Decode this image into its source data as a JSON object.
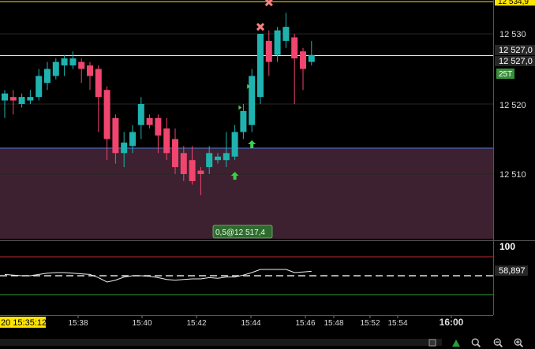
{
  "chart_data": {
    "type": "candlestick",
    "instrument_timeframe": "25T",
    "price_labels": [
      "12 534,9",
      "12 530",
      "12 527,0",
      "12 527,0",
      "12 520",
      "12 510"
    ],
    "cursor_time_label": "20 15:35:12",
    "time_labels": [
      "15:38",
      "15:40",
      "15:42",
      "15:44",
      "15:46",
      "15:48",
      "15:52",
      "15:54",
      "16:00"
    ],
    "order_label": "0,5@12 517,4",
    "candles": [
      {
        "o": 12520.5,
        "h": 12522,
        "l": 12518,
        "c": 12521.5
      },
      {
        "o": 12521,
        "h": 12522,
        "l": 12518.5,
        "c": 12520.5
      },
      {
        "o": 12520,
        "h": 12521.5,
        "l": 12519.5,
        "c": 12521
      },
      {
        "o": 12520.5,
        "h": 12522,
        "l": 12520,
        "c": 12521
      },
      {
        "o": 12521,
        "h": 12525,
        "l": 12520.5,
        "c": 12524
      },
      {
        "o": 12523,
        "h": 12526,
        "l": 12522,
        "c": 12525
      },
      {
        "o": 12524,
        "h": 12526.5,
        "l": 12523.5,
        "c": 12526
      },
      {
        "o": 12525.5,
        "h": 12527,
        "l": 12524,
        "c": 12526.5
      },
      {
        "o": 12525.5,
        "h": 12527.5,
        "l": 12525,
        "c": 12526.5
      },
      {
        "o": 12526,
        "h": 12526.5,
        "l": 12523,
        "c": 12525
      },
      {
        "o": 12525.5,
        "h": 12526,
        "l": 12522,
        "c": 12524
      },
      {
        "o": 12525,
        "h": 12525.5,
        "l": 12516,
        "c": 12521
      },
      {
        "o": 12522,
        "h": 12522.5,
        "l": 12512,
        "c": 12515
      },
      {
        "o": 12518,
        "h": 12518.5,
        "l": 12511.5,
        "c": 12513
      },
      {
        "o": 12513,
        "h": 12516,
        "l": 12511,
        "c": 12514.5
      },
      {
        "o": 12514,
        "h": 12517,
        "l": 12513,
        "c": 12516
      },
      {
        "o": 12517,
        "h": 12521,
        "l": 12515,
        "c": 12520
      },
      {
        "o": 12518,
        "h": 12518.5,
        "l": 12516.5,
        "c": 12517
      },
      {
        "o": 12518,
        "h": 12518.5,
        "l": 12513,
        "c": 12515.5
      },
      {
        "o": 12516.5,
        "h": 12518,
        "l": 12512,
        "c": 12513
      },
      {
        "o": 12515,
        "h": 12516.5,
        "l": 12510,
        "c": 12511
      },
      {
        "o": 12513,
        "h": 12514,
        "l": 12509,
        "c": 12510
      },
      {
        "o": 12512,
        "h": 12514,
        "l": 12508.5,
        "c": 12509
      },
      {
        "o": 12510.5,
        "h": 12511,
        "l": 12507,
        "c": 12510
      },
      {
        "o": 12511,
        "h": 12514,
        "l": 12510,
        "c": 12513
      },
      {
        "o": 12512,
        "h": 12513,
        "l": 12511.5,
        "c": 12512.5
      },
      {
        "o": 12512,
        "h": 12516,
        "l": 12511,
        "c": 12513
      },
      {
        "o": 12512.5,
        "h": 12517,
        "l": 12512,
        "c": 12516
      },
      {
        "o": 12516,
        "h": 12520,
        "l": 12515,
        "c": 12519
      },
      {
        "o": 12517,
        "h": 12525,
        "l": 12516,
        "c": 12524
      },
      {
        "o": 12521,
        "h": 12530,
        "l": 12520,
        "c": 12530
      },
      {
        "o": 12529,
        "h": 12530.5,
        "l": 12524,
        "c": 12526
      },
      {
        "o": 12527,
        "h": 12531,
        "l": 12526,
        "c": 12530.5
      },
      {
        "o": 12529,
        "h": 12533,
        "l": 12528,
        "c": 12531
      },
      {
        "o": 12529.5,
        "h": 12530,
        "l": 12520,
        "c": 12526.5
      },
      {
        "o": 12527.5,
        "h": 12528,
        "l": 12522,
        "c": 12525
      },
      {
        "o": 12526,
        "h": 12529,
        "l": 12525.5,
        "c": 12527
      }
    ],
    "oscillator": {
      "label_top": "100",
      "value_label": "58,897",
      "levels": [
        80,
        50,
        20
      ],
      "values": [
        52,
        51,
        50,
        50,
        52,
        54,
        55,
        55,
        54,
        53,
        52,
        47,
        40,
        43,
        48,
        50,
        50,
        49,
        47,
        44,
        43,
        44,
        45,
        45,
        47,
        46,
        48,
        48,
        51,
        55,
        60,
        60,
        60,
        60,
        55,
        56,
        57
      ]
    }
  },
  "colors": {
    "bull": "#1fb3b0",
    "bear": "#f0456f",
    "zone": "#3e2130",
    "blue_line": "#4a77e0",
    "order_box": "#2f6b2f",
    "price_box": "#272727",
    "timeframe_box": "#3a8f3a",
    "cursor_box": "#ffe400"
  },
  "icons": [
    "scroll-left-icon",
    "lock-icon",
    "zoom-fit-icon",
    "zoom-out-icon",
    "zoom-in-icon"
  ]
}
